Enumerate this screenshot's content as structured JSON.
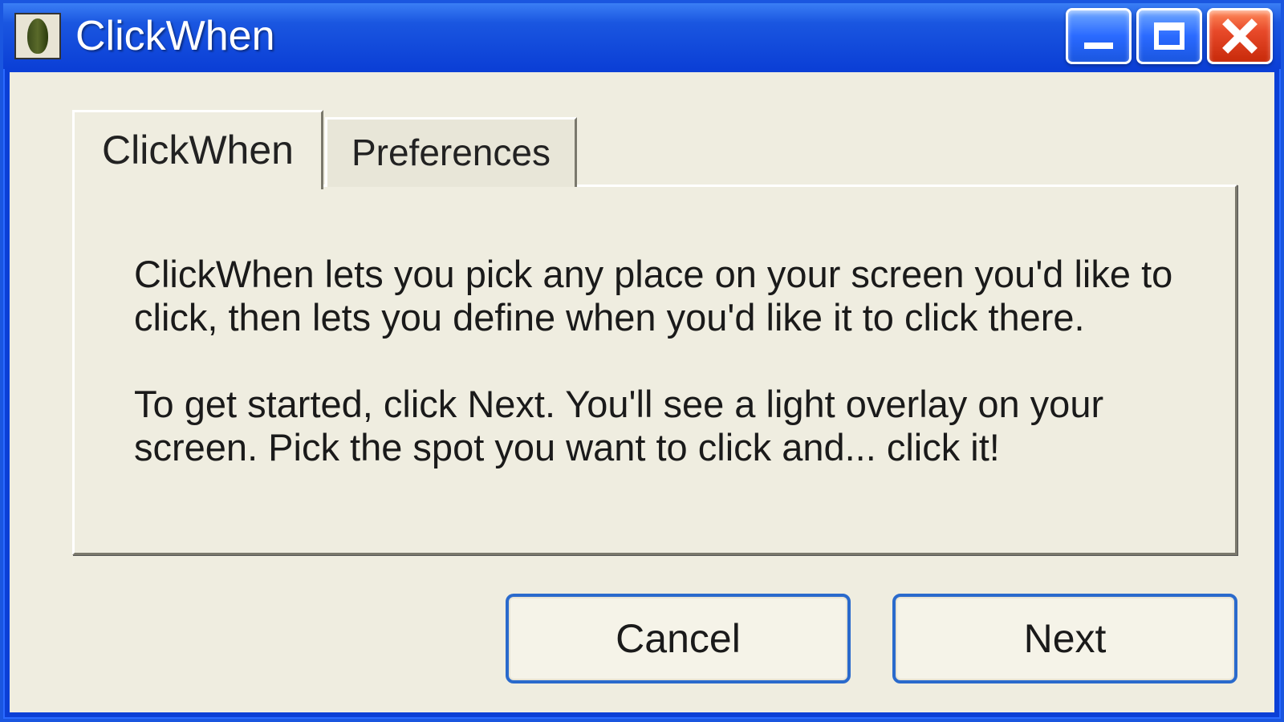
{
  "window": {
    "title": "ClickWhen"
  },
  "tabs": [
    {
      "label": "ClickWhen",
      "active": true
    },
    {
      "label": "Preferences",
      "active": false
    }
  ],
  "content": {
    "paragraph1": "ClickWhen lets you pick any place on your screen you'd like to click, then lets you define when you'd like it to click there.",
    "paragraph2": "To get started, click Next.  You'll see a light overlay on your screen.  Pick the spot you want to click and... click it!"
  },
  "buttons": {
    "cancel": "Cancel",
    "next": "Next"
  },
  "icons": {
    "app": "clickwhen-app-icon",
    "minimize": "minimize-icon",
    "maximize": "maximize-icon",
    "close": "close-icon"
  },
  "colors": {
    "titlebar": "#1a56e0",
    "client": "#efede0",
    "button_border": "#2a6acc",
    "close_button": "#e84a2a"
  }
}
